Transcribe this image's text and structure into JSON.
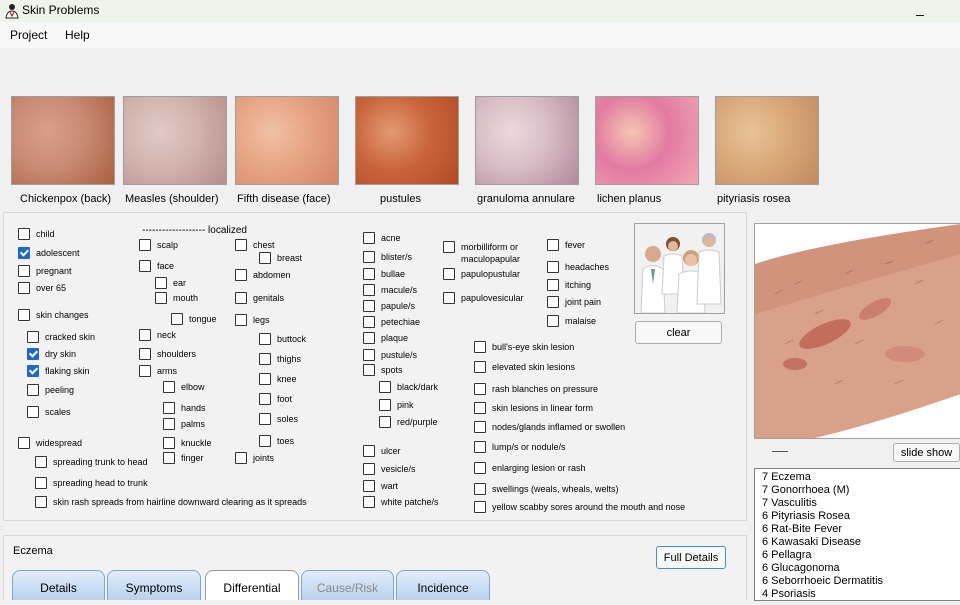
{
  "window": {
    "title": "Skin Problems",
    "minimize_glyph": "_"
  },
  "menu": [
    "Project",
    "Help"
  ],
  "thumbnails": [
    {
      "label": "Chickenpox (back)",
      "colors": [
        "#c88a73",
        "#a8603f",
        "#d8a08a"
      ]
    },
    {
      "label": "Measles (shoulder)",
      "colors": [
        "#d1b3ad",
        "#b68e8a",
        "#e1cac5"
      ]
    },
    {
      "label": "Fifth disease (face)",
      "colors": [
        "#e6a482",
        "#d58567",
        "#f0c2a5"
      ]
    },
    {
      "label": "pustules",
      "colors": [
        "#c9653c",
        "#b24a24",
        "#e49a73"
      ]
    },
    {
      "label": "granuloma annulare",
      "colors": [
        "#d7bcc4",
        "#b0889a",
        "#eed9de"
      ]
    },
    {
      "label": "lichen planus",
      "colors": [
        "#e27aa2",
        "#f2a6b5",
        "#f6c6b1"
      ]
    },
    {
      "label": "pityriasis rosea",
      "colors": [
        "#d9a878",
        "#c08a5e",
        "#e8c398"
      ]
    }
  ],
  "localized_heading": "------------------- localized",
  "checkboxes": {
    "col1": [
      {
        "label": "child",
        "checked": false
      },
      {
        "label": "adolescent",
        "checked": true
      },
      {
        "label": "pregnant",
        "checked": false
      },
      {
        "label": "over 65",
        "checked": false
      },
      {
        "label": "skin changes",
        "checked": false
      },
      {
        "label": "cracked skin",
        "checked": false
      },
      {
        "label": "dry skin",
        "checked": true
      },
      {
        "label": "flaking skin",
        "checked": true
      },
      {
        "label": "peeling",
        "checked": false
      },
      {
        "label": "scales",
        "checked": false
      },
      {
        "label": "widespread",
        "checked": false
      },
      {
        "label": "spreading trunk to head",
        "checked": false
      },
      {
        "label": "spreading head to trunk",
        "checked": false
      },
      {
        "label": "skin rash spreads from hairline downward clearing as it spreads",
        "checked": false
      }
    ],
    "col2": [
      {
        "label": "scalp",
        "checked": false
      },
      {
        "label": "face",
        "checked": false
      },
      {
        "label": "ear",
        "checked": false
      },
      {
        "label": "mouth",
        "checked": false
      },
      {
        "label": "tongue",
        "checked": false
      },
      {
        "label": "neck",
        "checked": false
      },
      {
        "label": "shoulders",
        "checked": false
      },
      {
        "label": "arms",
        "checked": false
      },
      {
        "label": "elbow",
        "checked": false
      },
      {
        "label": "hands",
        "checked": false
      },
      {
        "label": "palms",
        "checked": false
      },
      {
        "label": "knuckle",
        "checked": false
      },
      {
        "label": "finger",
        "checked": false
      }
    ],
    "col3": [
      {
        "label": "chest",
        "checked": false
      },
      {
        "label": "breast",
        "checked": false
      },
      {
        "label": "abdomen",
        "checked": false
      },
      {
        "label": "genitals",
        "checked": false
      },
      {
        "label": "legs",
        "checked": false
      },
      {
        "label": "buttock",
        "checked": false
      },
      {
        "label": "thighs",
        "checked": false
      },
      {
        "label": "knee",
        "checked": false
      },
      {
        "label": "foot",
        "checked": false
      },
      {
        "label": "soles",
        "checked": false
      },
      {
        "label": "toes",
        "checked": false
      },
      {
        "label": "joints",
        "checked": false
      }
    ],
    "col4": [
      {
        "label": "acne",
        "checked": false
      },
      {
        "label": "blister/s",
        "checked": false
      },
      {
        "label": "bullae",
        "checked": false
      },
      {
        "label": "macule/s",
        "checked": false
      },
      {
        "label": "papule/s",
        "checked": false
      },
      {
        "label": "petechiae",
        "checked": false
      },
      {
        "label": "plaque",
        "checked": false
      },
      {
        "label": "pustule/s",
        "checked": false
      },
      {
        "label": "spots",
        "checked": false
      },
      {
        "label": "black/dark",
        "checked": false
      },
      {
        "label": "pink",
        "checked": false
      },
      {
        "label": "red/purple",
        "checked": false
      },
      {
        "label": "ulcer",
        "checked": false
      },
      {
        "label": "vesicle/s",
        "checked": false
      },
      {
        "label": "wart",
        "checked": false
      },
      {
        "label": "white patche/s",
        "checked": false
      }
    ],
    "col5": [
      {
        "label": "morbilliform or",
        "label2": "maculopapular",
        "checked": false
      },
      {
        "label": "papulopustular",
        "checked": false
      },
      {
        "label": "papulovesicular",
        "checked": false
      }
    ],
    "col6": [
      {
        "label": "fever",
        "checked": false
      },
      {
        "label": "headaches",
        "checked": false
      },
      {
        "label": "itching",
        "checked": false
      },
      {
        "label": "joint pain",
        "checked": false
      },
      {
        "label": "malaise",
        "checked": false
      }
    ],
    "col7": [
      {
        "label": "bull's-eye skin lesion",
        "checked": false
      },
      {
        "label": "elevated skin lesions",
        "checked": false
      },
      {
        "label": "rash blanches on pressure",
        "checked": false
      },
      {
        "label": "skin lesions in linear form",
        "checked": false
      },
      {
        "label": "nodes/glands inflamed or swollen",
        "checked": false
      },
      {
        "label": "lump/s or nodule/s",
        "checked": false
      },
      {
        "label": "enlarging lesion or rash",
        "checked": false
      },
      {
        "label": "swellings (weals, wheals, welts)",
        "checked": false
      },
      {
        "label": "yellow scabby sores around the mouth and nose",
        "checked": false
      }
    ]
  },
  "buttons": {
    "clear": "clear",
    "slide_show": "slide show",
    "full_details": "Full Details"
  },
  "results": [
    "7 Eczema",
    "7 Gonorrhoea (M)",
    "7 Vasculitis",
    "6 Pityriasis Rosea",
    "6 Rat-Bite Fever",
    "6 Kawasaki Disease",
    "6 Pellagra",
    "6 Glucagonoma",
    "6 Seborrhoeic Dermatitis",
    "4 Psoriasis"
  ],
  "selected_disease": "Eczema",
  "tabs": [
    {
      "label": "Details",
      "state": "normal"
    },
    {
      "label": "Symptoms",
      "state": "normal"
    },
    {
      "label": "Differential",
      "state": "active"
    },
    {
      "label": "Cause/Risk",
      "state": "disabled"
    },
    {
      "label": "Incidence",
      "state": "normal"
    }
  ],
  "icons": {
    "app": "doctor-icon",
    "minimize": "minimize-icon",
    "doctors_photo": "doctors-photo",
    "preview": "skin-preview-image"
  }
}
